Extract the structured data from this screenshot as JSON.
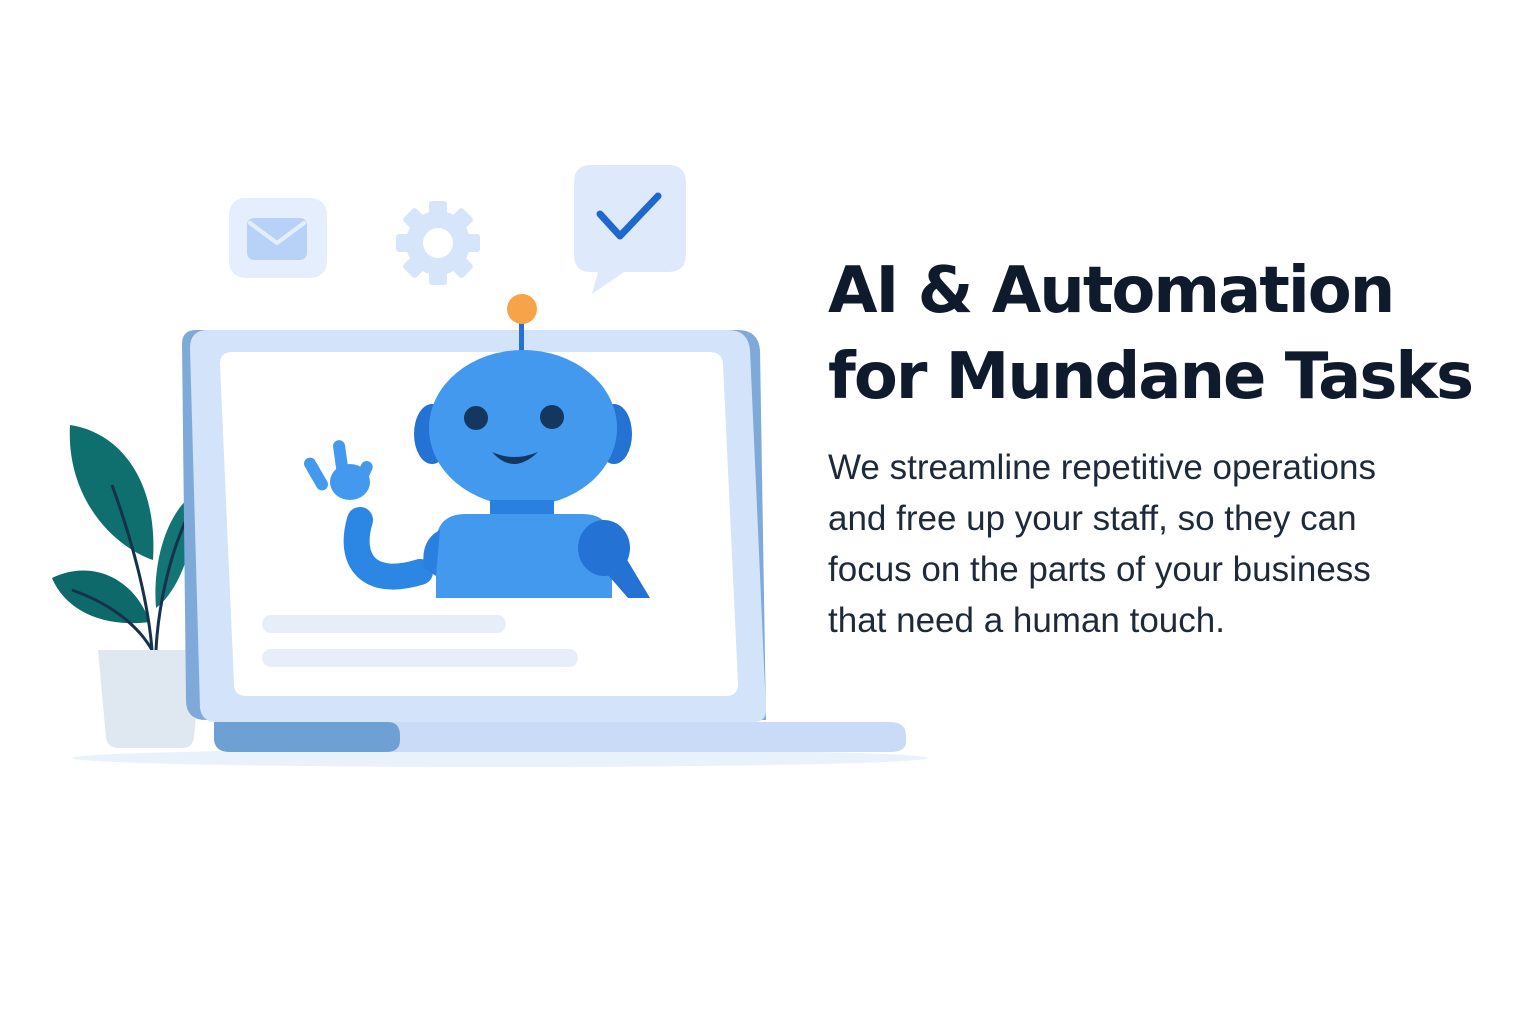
{
  "hero": {
    "headline": {
      "line1": "AI & Automation",
      "line2": "for Mundane Tasks"
    },
    "description": {
      "line1": "We streamline repetitive operations",
      "line2": "and free up your staff, so they can",
      "line3": "focus on the parts of your business",
      "line4": "that need a human touch."
    }
  },
  "illustration": {
    "icons": [
      "mail-icon",
      "gear-icon",
      "checkmark-chat-icon",
      "robot-icon",
      "plant-icon",
      "laptop-icon"
    ]
  },
  "colors": {
    "heading": "#0f1b2d",
    "body_text": "#1e2a3a",
    "robot_blue": "#4299ee",
    "robot_dark_blue": "#2472d3",
    "antenna_orange": "#f6a34a",
    "leaf_teal": "#0f6e6e",
    "laptop_frame": "#d3e3fa",
    "light_icon_bg": "#e3eefc"
  }
}
